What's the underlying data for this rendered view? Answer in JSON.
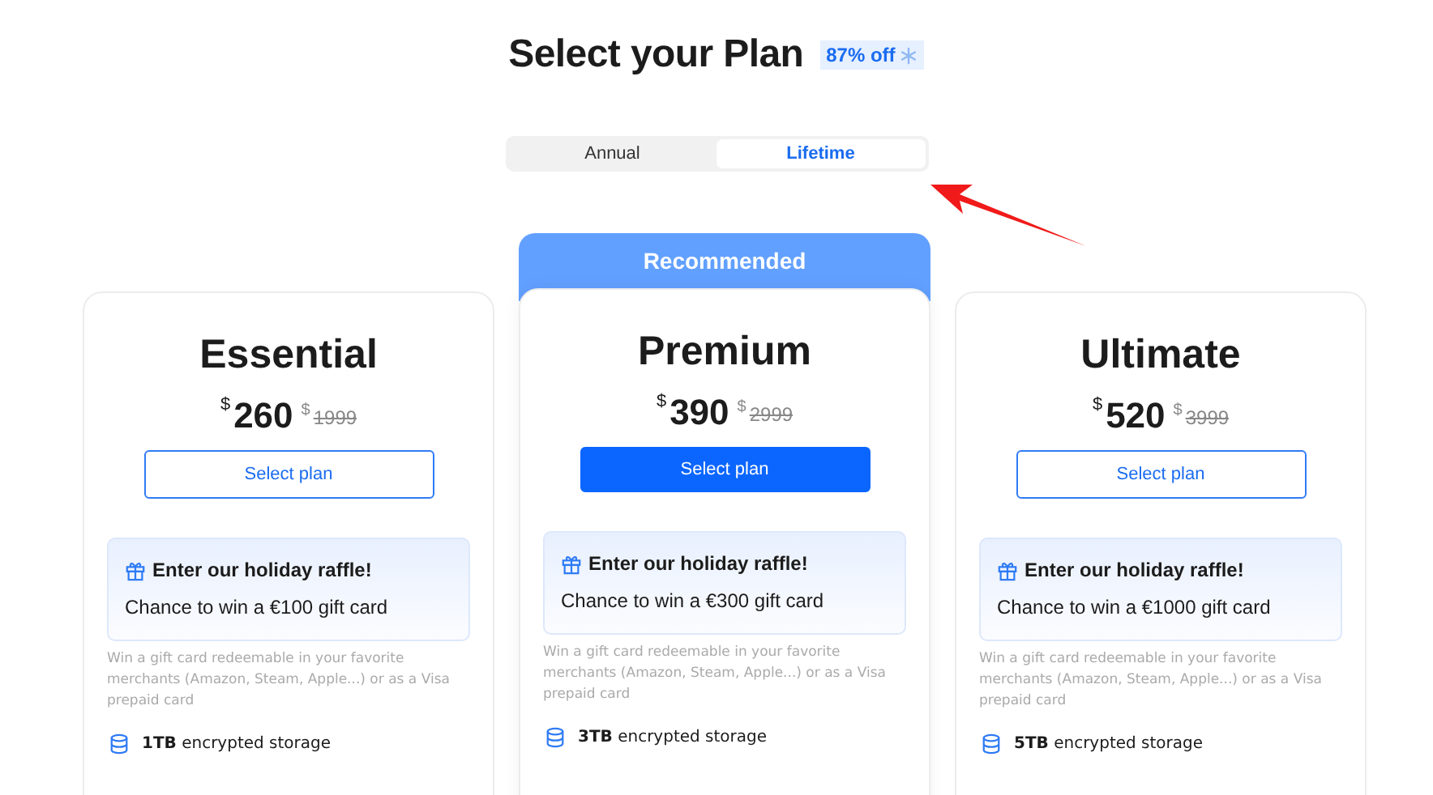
{
  "title": "Select your Plan",
  "discount_badge": "87% off",
  "billing_tabs": [
    {
      "label": "Annual",
      "selected": false
    },
    {
      "label": "Lifetime",
      "selected": true
    }
  ],
  "plans": [
    {
      "name": "Essential",
      "recommended": false,
      "currency": "$",
      "price": "260",
      "old_currency": "$",
      "old_price": "1999",
      "button": "Select plan",
      "raffle_title": "Enter our holiday raffle!",
      "raffle_text": "Chance to win a €100 gift card",
      "fine_print": "Win a gift card redeemable in your favorite merchants (Amazon, Steam, Apple...) or as a Visa prepaid card",
      "feature": "**1TB** encrypted storage"
    },
    {
      "name": "Premium",
      "recommended": true,
      "ribbon": "Recommended",
      "currency": "$",
      "price": "390",
      "old_currency": "$",
      "old_price": "2999",
      "button": "Select plan",
      "raffle_title": "Enter our holiday raffle!",
      "raffle_text": "Chance to win a €300 gift card",
      "fine_print": "Win a gift card redeemable in your favorite merchants (Amazon, Steam, Apple...) or as a Visa prepaid card",
      "feature": "**3TB** encrypted storage"
    },
    {
      "name": "Ultimate",
      "recommended": false,
      "currency": "$",
      "price": "520",
      "old_currency": "$",
      "old_price": "3999",
      "button": "Select plan",
      "raffle_title": "Enter our holiday raffle!",
      "raffle_text": "Chance to win a €1000 gift card",
      "fine_print": "Win a gift card redeemable in your favorite merchants (Amazon, Steam, Apple...) or as a Visa prepaid card",
      "feature": "**5TB** encrypted storage"
    }
  ]
}
